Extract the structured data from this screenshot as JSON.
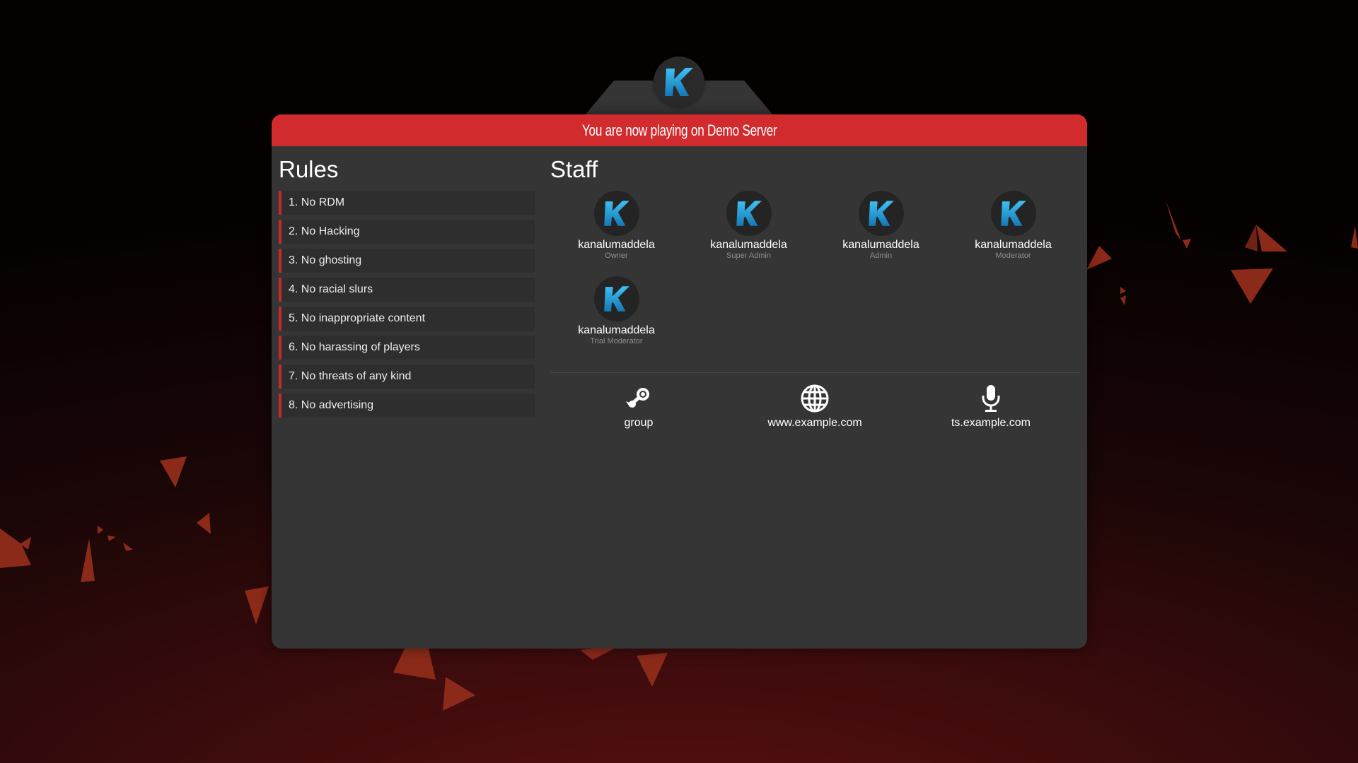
{
  "colors": {
    "accent": "#d22b2e",
    "panel": "#353535",
    "shard": "#8c2a1a",
    "logo_blue": "#1aa7e0"
  },
  "logo": {
    "letter": "K",
    "icon": "k-logo-icon"
  },
  "banner": {
    "text": "You are now playing on Demo Server"
  },
  "rules": {
    "title": "Rules",
    "items": [
      "1. No RDM",
      "2. No Hacking",
      "3. No ghosting",
      "4. No racial slurs",
      "5. No inappropriate content",
      "6. No harassing of players",
      "7. No threats of any kind",
      "8. No advertising"
    ]
  },
  "staff": {
    "title": "Staff",
    "members": [
      {
        "name": "kanalumaddela",
        "role": "Owner"
      },
      {
        "name": "kanalumaddela",
        "role": "Super Admin"
      },
      {
        "name": "kanalumaddela",
        "role": "Admin"
      },
      {
        "name": "kanalumaddela",
        "role": "Moderator"
      },
      {
        "name": "kanalumaddela",
        "role": "Trial Moderator"
      }
    ]
  },
  "links": [
    {
      "label": "group",
      "icon": "steam-icon"
    },
    {
      "label": "www.example.com",
      "icon": "globe-icon"
    },
    {
      "label": "ts.example.com",
      "icon": "microphone-icon"
    }
  ]
}
